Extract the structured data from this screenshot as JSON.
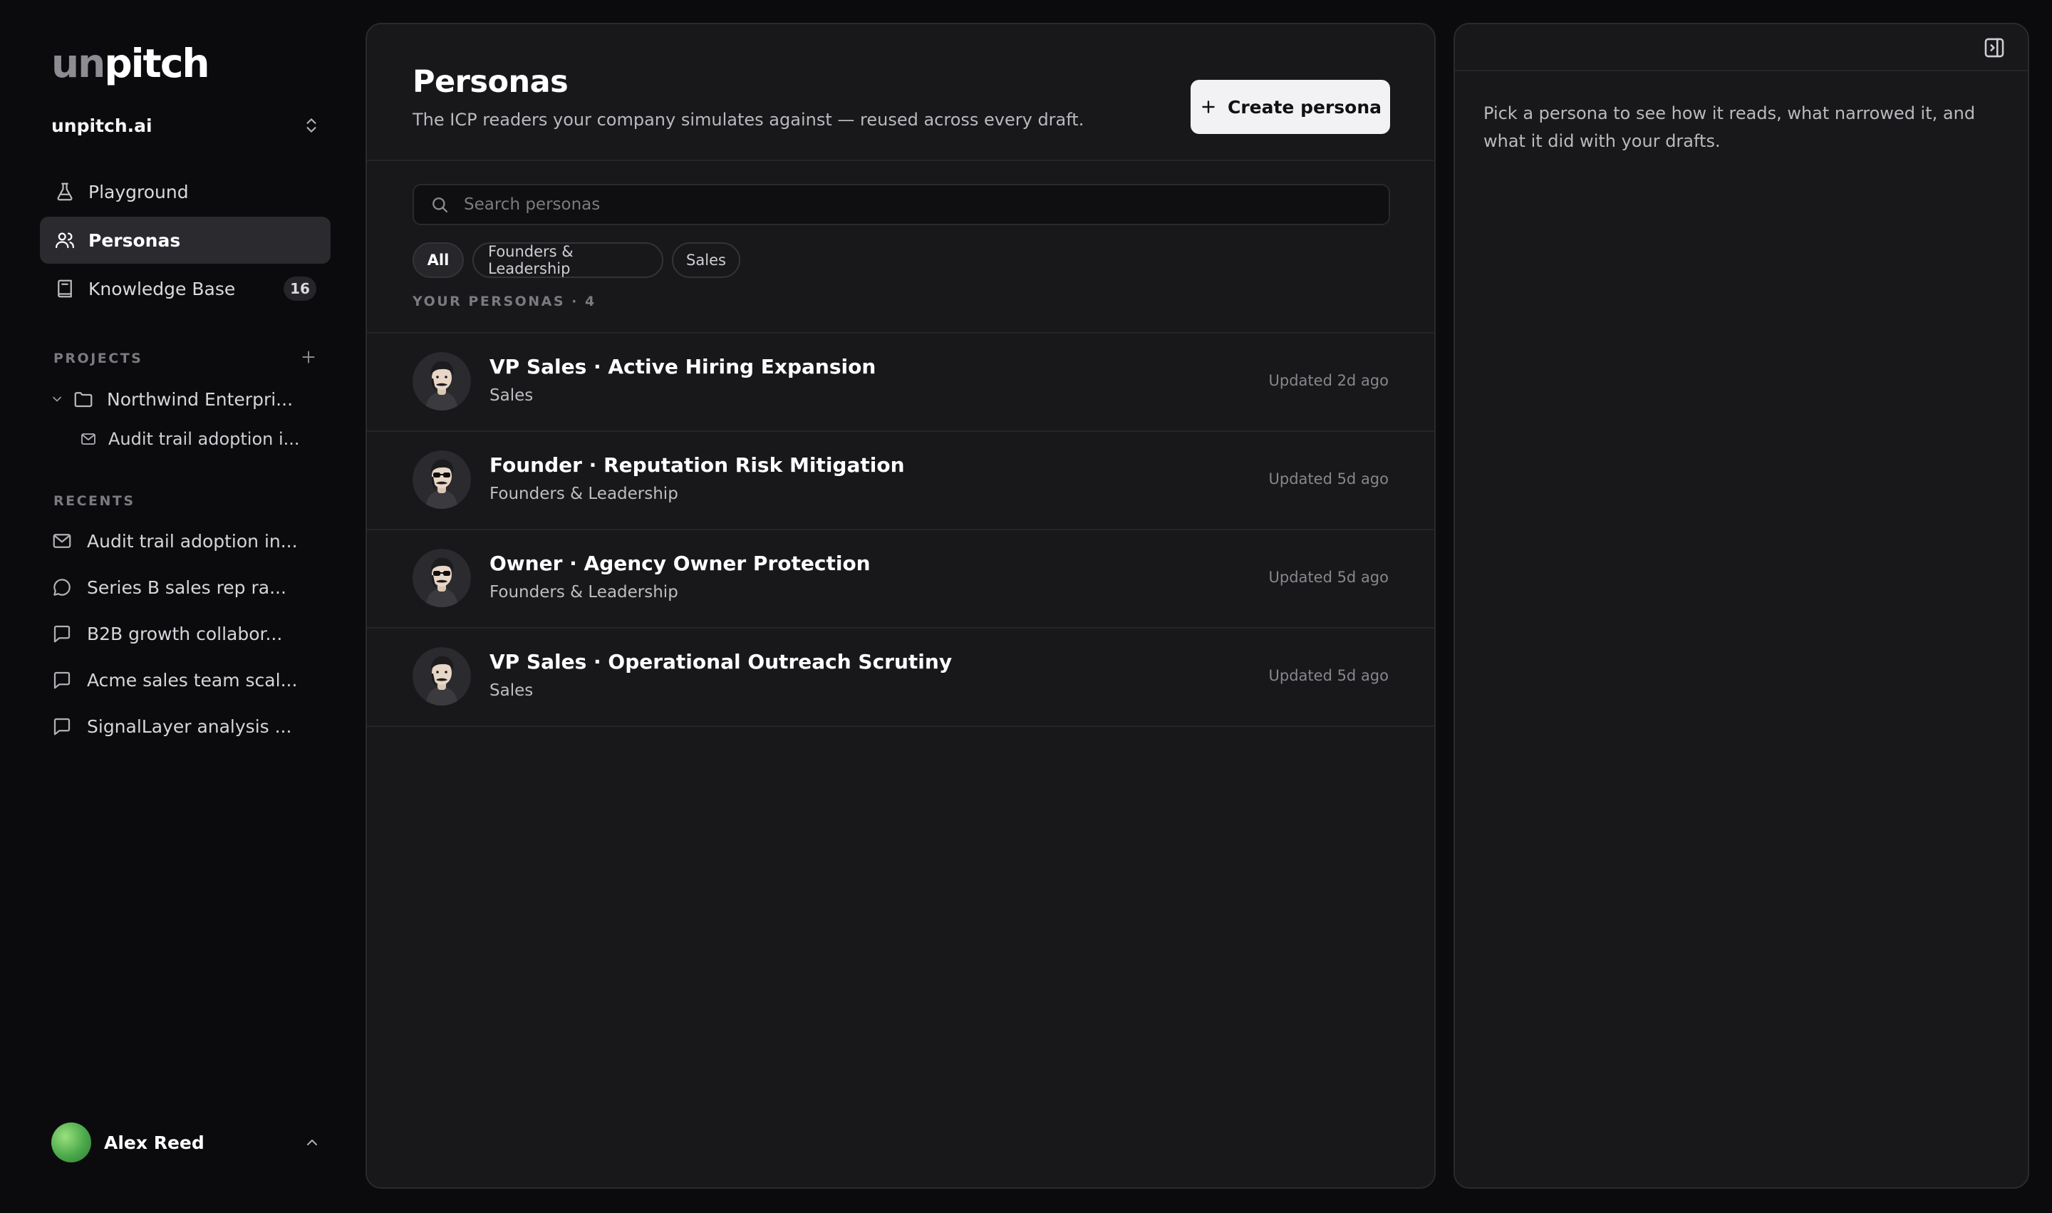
{
  "brand": {
    "logo_un": "un",
    "logo_pitch": "pitch"
  },
  "workspace": {
    "name": "unpitch.ai"
  },
  "nav": [
    {
      "label": "Playground",
      "icon": "flask-icon"
    },
    {
      "label": "Personas",
      "icon": "users-icon",
      "active": true
    },
    {
      "label": "Knowledge Base",
      "icon": "book-icon",
      "badge": "16"
    }
  ],
  "projects": {
    "section_label": "PROJECTS",
    "folder": "Northwind Enterpri...",
    "child": "Audit trail adoption i..."
  },
  "recents": {
    "section_label": "RECENTS",
    "items": [
      {
        "label": "Audit trail adoption in...",
        "icon": "mail-icon"
      },
      {
        "label": "Series B sales rep ra...",
        "icon": "chat-bubble-icon"
      },
      {
        "label": "B2B growth collabor...",
        "icon": "message-square-icon"
      },
      {
        "label": "Acme sales team scal...",
        "icon": "message-square-icon"
      },
      {
        "label": "SignalLayer analysis ...",
        "icon": "message-square-icon"
      }
    ]
  },
  "user": {
    "name": "Alex Reed"
  },
  "main": {
    "title": "Personas",
    "subtitle": "The ICP readers your company simulates against — reused across every draft.",
    "create_label": "Create persona",
    "search_placeholder": "Search personas",
    "filters": [
      "All",
      "Founders & Leadership",
      "Sales"
    ],
    "active_filter": "All",
    "list_label": "YOUR PERSONAS · 4",
    "personas": [
      {
        "title": "VP Sales · Active Hiring Expansion",
        "category": "Sales",
        "updated": "Updated 2d ago",
        "sunglasses": false
      },
      {
        "title": "Founder · Reputation Risk Mitigation",
        "category": "Founders & Leadership",
        "updated": "Updated 5d ago",
        "sunglasses": true
      },
      {
        "title": "Owner · Agency Owner Protection",
        "category": "Founders & Leadership",
        "updated": "Updated 5d ago",
        "sunglasses": true
      },
      {
        "title": "VP Sales · Operational Outreach Scrutiny",
        "category": "Sales",
        "updated": "Updated 5d ago",
        "sunglasses": false
      }
    ]
  },
  "detail": {
    "hint": "Pick a persona to see how it reads, what narrowed it, and what it did with your drafts."
  },
  "colors": {
    "background": "#0b0b0d",
    "panel": "#18181b",
    "active_nav": "#2a2a2f",
    "primary_button": "#f2f2f4"
  }
}
